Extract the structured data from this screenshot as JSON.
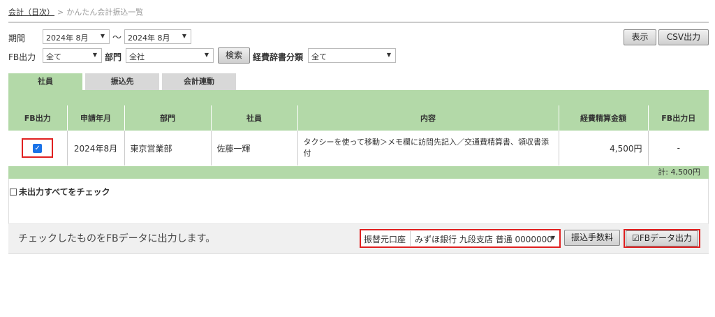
{
  "breadcrumb": {
    "parent": "会計（日次）",
    "separator": ">",
    "current": "かんたん会計振込一覧"
  },
  "filters": {
    "period_label": "期間",
    "period_from": "2024年 8月",
    "period_to": "2024年 8月",
    "tilde": "〜",
    "fb_label": "FB出力",
    "fb_value": "全て",
    "dept_label": "部門",
    "dept_value": "全社",
    "search_button": "検索",
    "category_label": "経費辞書分類",
    "category_value": "全て",
    "show_button": "表示",
    "csv_button": "CSV出力"
  },
  "tabs": [
    "社員",
    "振込先",
    "会計連動"
  ],
  "table": {
    "headers": [
      "FB出力",
      "申請年月",
      "部門",
      "社員",
      "内容",
      "経費精算金額",
      "FB出力日"
    ],
    "rows": [
      {
        "checked": true,
        "month": "2024年8月",
        "dept": "東京営業部",
        "employee": "佐藤一輝",
        "content": "タクシーを使って移動＞メモ欄に訪問先記入／交通費精算書、領収書添付",
        "amount": "4,500円",
        "fb_date": "-"
      }
    ],
    "total": "計: 4,500円"
  },
  "check_all_label": "未出力すべてをチェック",
  "bottom": {
    "message": "チェックしたものをFBデータに出力します。",
    "account_label": "振替元口座",
    "account_value": "みずほ銀行 九段支店 普通 0000000",
    "fee_button": "振込手数料",
    "fb_output_button": "FBデータ出力"
  },
  "colors": {
    "accent_green": "#b3d9a8",
    "highlight_red": "#e02020",
    "checkbox_blue": "#1a73e8"
  }
}
